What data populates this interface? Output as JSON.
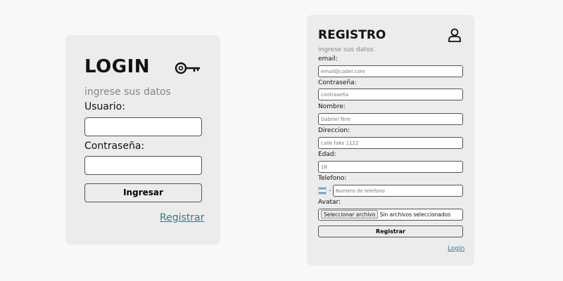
{
  "login": {
    "title": "LOGIN",
    "subtitle": "ingrese sus datos",
    "usuario_label": "Usuario:",
    "password_label": "Contraseña:",
    "submit_label": "Ingresar",
    "register_link": "Registrar"
  },
  "registro": {
    "title": "REGISTRO",
    "subtitle": "ingrese sus datos",
    "email": {
      "label": "email:",
      "placeholder": "email@coder.com"
    },
    "password": {
      "label": "Contraseña:",
      "placeholder": "contraseña"
    },
    "nombre": {
      "label": "Nombre:",
      "placeholder": "Gabriel Tere"
    },
    "direccion": {
      "label": "Direccion:",
      "placeholder": "calle fake 1122"
    },
    "edad": {
      "label": "Edad:",
      "placeholder": "18"
    },
    "telefono": {
      "label": "Telefono:",
      "placeholder": "Numero de telefono"
    },
    "avatar": {
      "label": "Avatar:",
      "button": "Seleccionar archivo",
      "status": "Sin archivos seleccionados"
    },
    "submit_label": "Registrar",
    "login_link": "Login"
  },
  "icons": {
    "login": "key-icon",
    "registro": "user-icon"
  },
  "colors": {
    "card_bg": "#ececec",
    "link": "#2e7d8f",
    "page_bg": "#f8f8f8"
  }
}
